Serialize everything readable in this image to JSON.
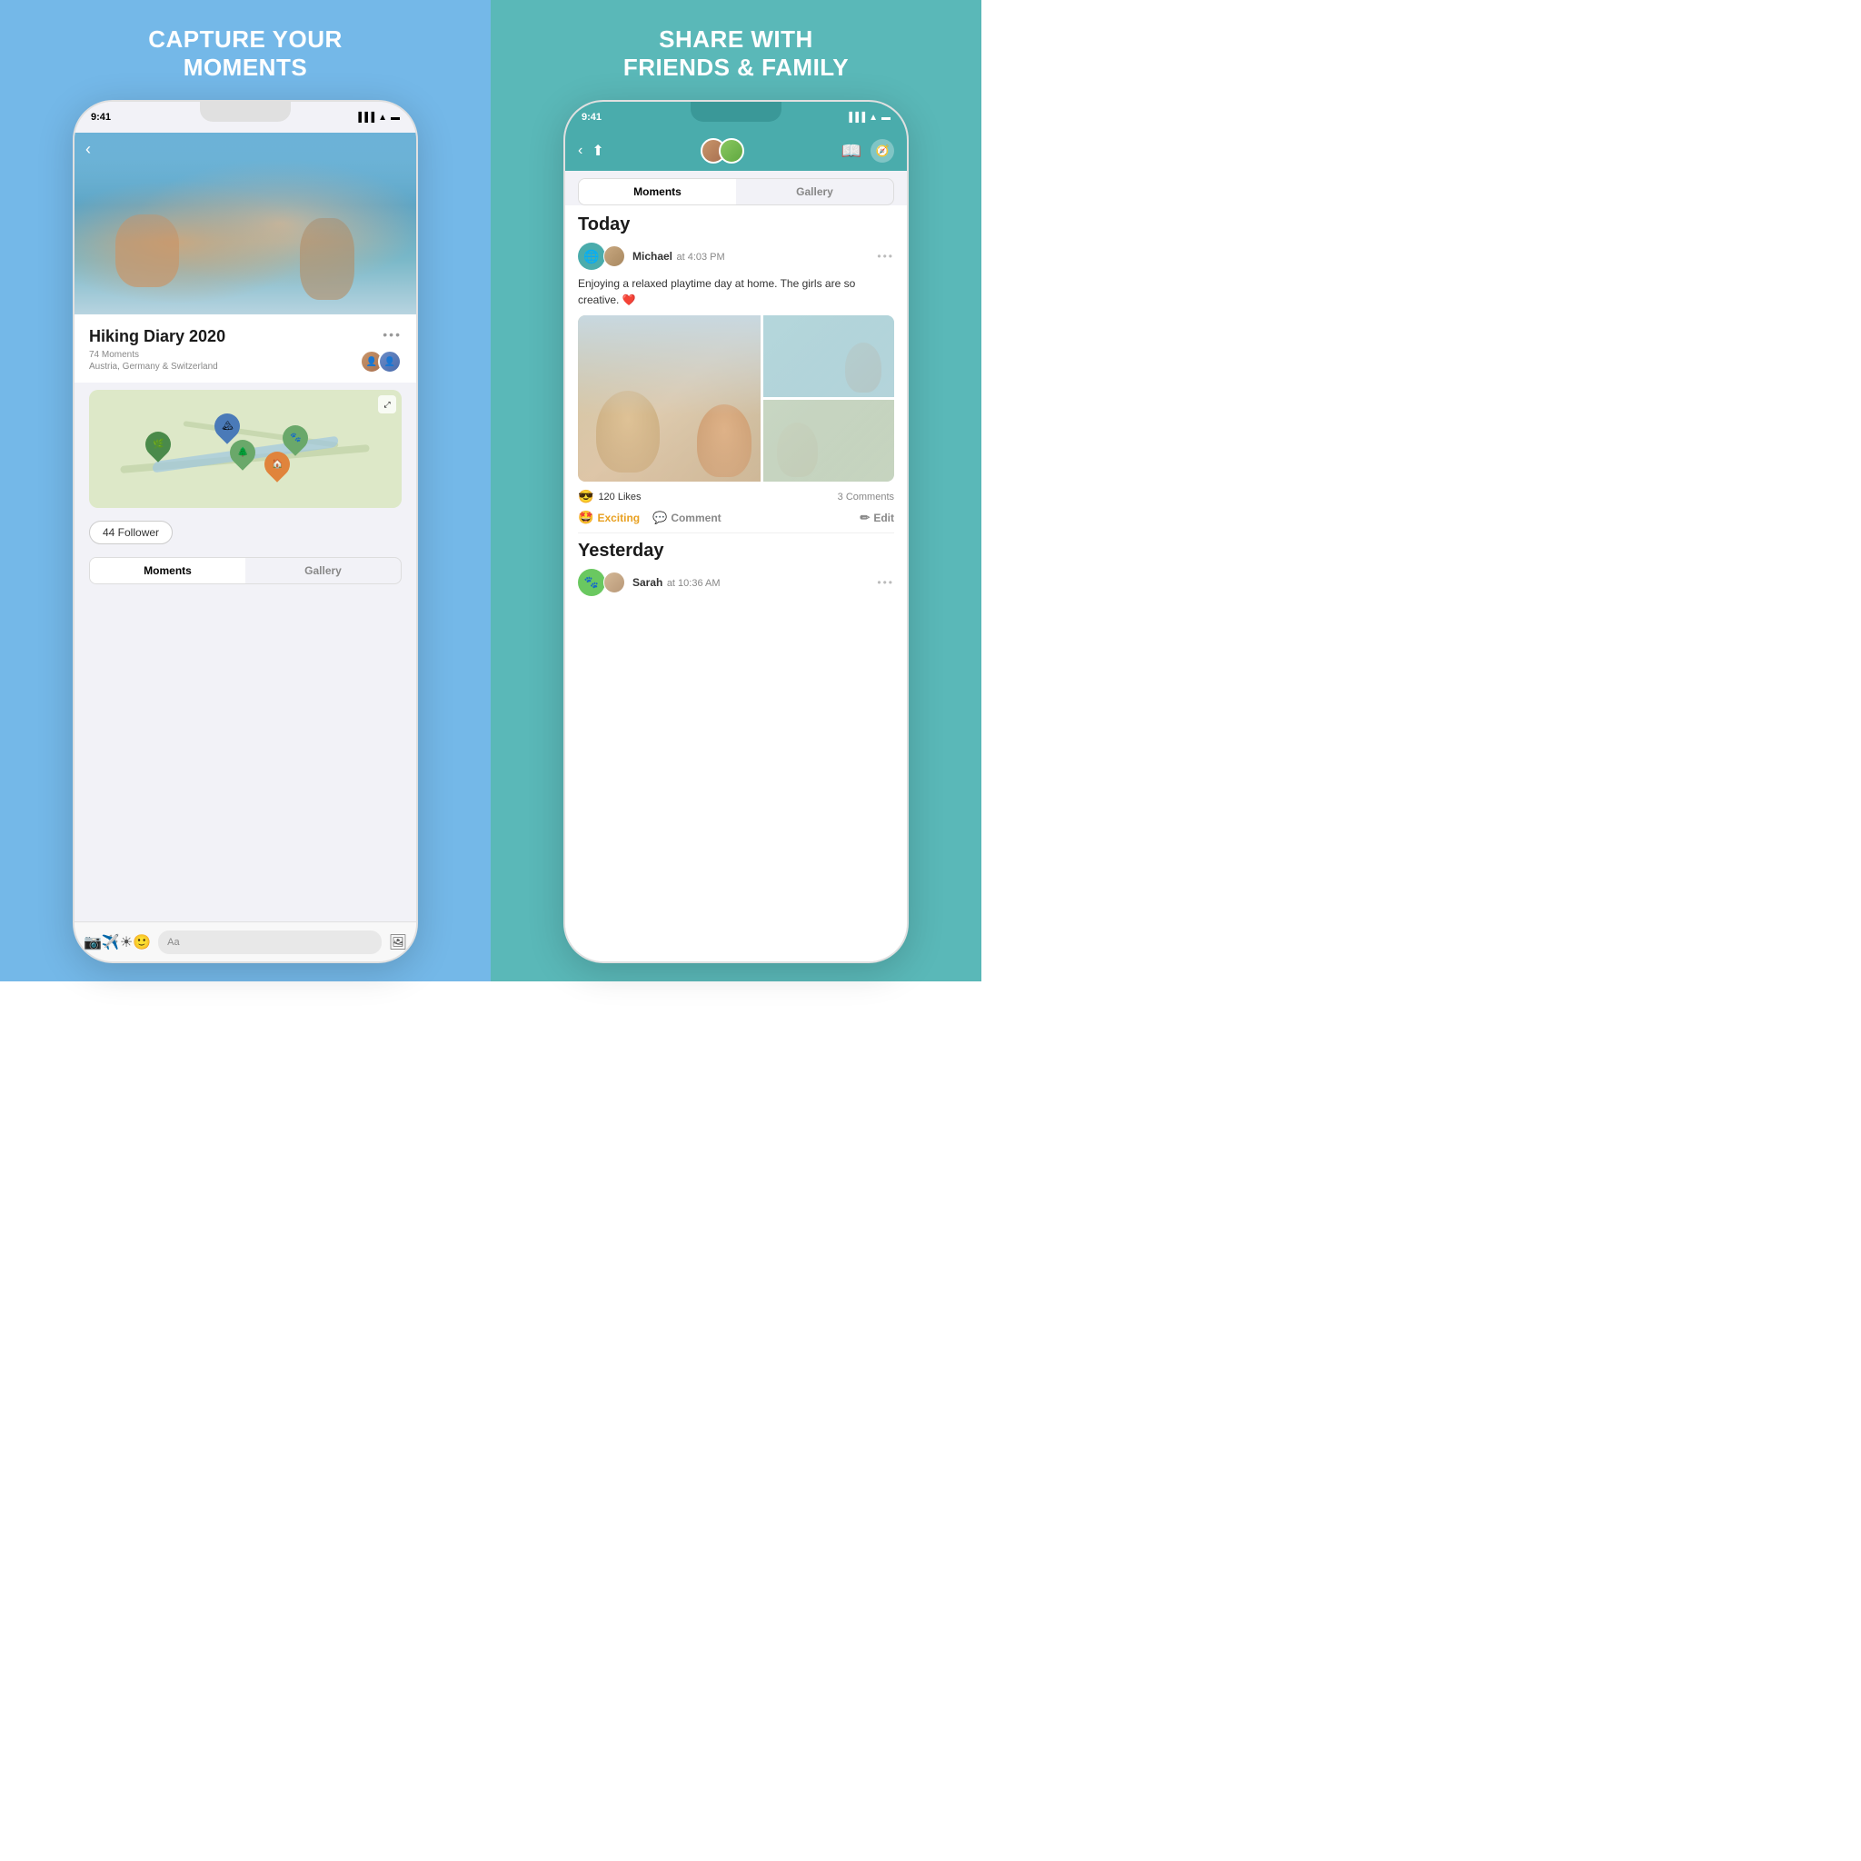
{
  "left_panel": {
    "title_line1": "CAPTURE YOUR",
    "title_line2": "MOMENTS",
    "status_time": "9:41",
    "diary": {
      "title": "Hiking Diary 2020",
      "moments_count": "74 Moments",
      "location": "Austria, Germany & Switzerland",
      "follower_btn": "44 Follower"
    },
    "tabs": {
      "moments": "Moments",
      "gallery": "Gallery"
    },
    "toolbar": {
      "text_placeholder": "Aa"
    }
  },
  "right_panel": {
    "title_line1": "SHARE WITH",
    "title_line2": "FRIENDS & FAMILY",
    "status_time": "9:41",
    "tabs": {
      "moments": "Moments",
      "gallery": "Gallery"
    },
    "today_section": {
      "title": "Today",
      "post": {
        "username": "Michael",
        "time": "at 4:03 PM",
        "text": "Enjoying a relaxed playtime day at home. The girls are so creative. ❤️",
        "likes": "120 Likes",
        "comments": "3 Comments",
        "reactions": {
          "exciting_label": "Exciting",
          "comment_label": "Comment",
          "edit_label": "Edit"
        }
      }
    },
    "yesterday_section": {
      "title": "Yesterday",
      "post": {
        "username": "Sarah",
        "time": "at 10:36 AM"
      }
    }
  }
}
